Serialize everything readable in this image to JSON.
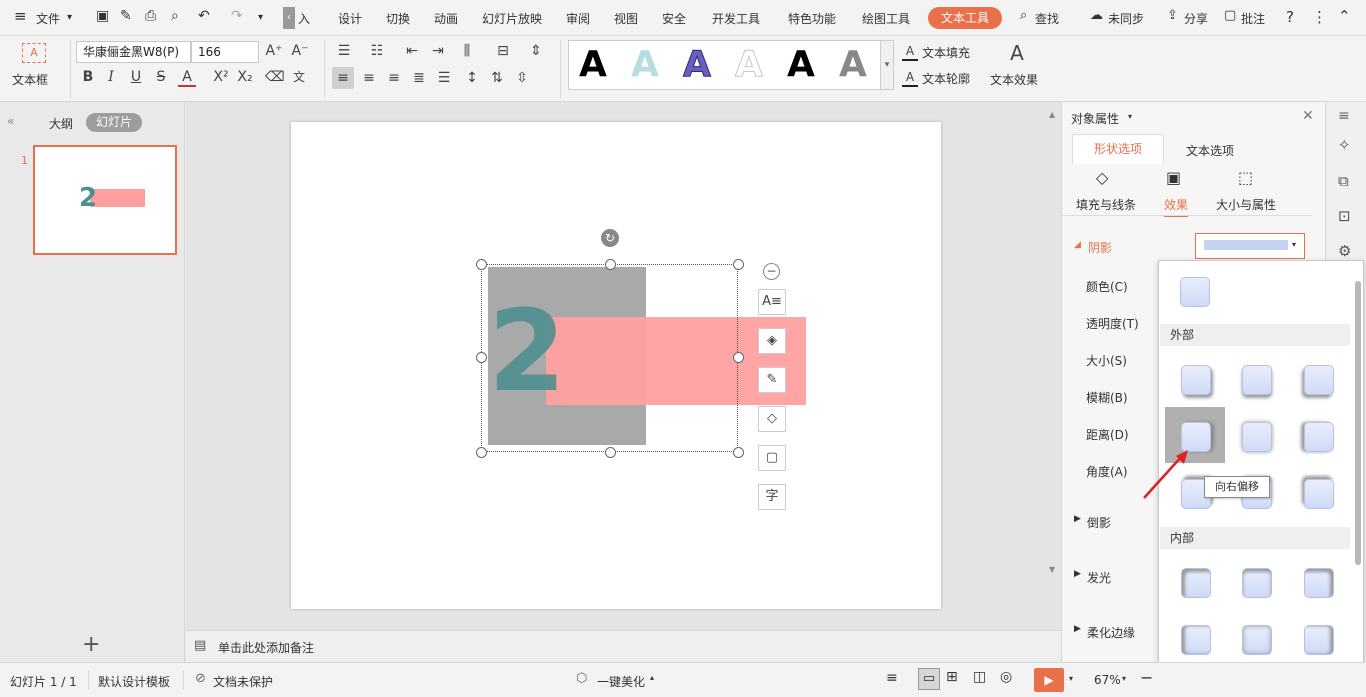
{
  "menubar": {
    "file_label": "文件",
    "tabs": [
      "设计",
      "切换",
      "动画",
      "幻灯片放映",
      "审阅",
      "视图",
      "安全",
      "开发工具",
      "特色功能",
      "绘图工具"
    ],
    "truncated_tab": "入",
    "active_tab": "文本工具",
    "search_label": "查找",
    "sync_label": "未同步",
    "share_label": "分享",
    "comment_label": "批注"
  },
  "ribbon": {
    "textbox_label": "文本框",
    "font_name": "华康俪金黑W8(P)",
    "font_size": "166",
    "art_letter": "A",
    "fill_label": "文本填充",
    "outline_label": "文本轮廓",
    "effect_label": "文本效果"
  },
  "leftpane": {
    "tab_outline": "大纲",
    "tab_slides": "幻灯片",
    "slide_number": "1",
    "thumb_text": "2"
  },
  "slide": {
    "big_text": "2"
  },
  "notes": {
    "placeholder": "单击此处添加备注"
  },
  "panel": {
    "title": "对象属性",
    "tab_shape": "形状选项",
    "tab_text": "文本选项",
    "sub_fill": "填充与线条",
    "sub_effect": "效果",
    "sub_size": "大小与属性",
    "section_shadow": "阴影",
    "color_label": "颜色(C)",
    "transparency_label": "透明度(T)",
    "size_label": "大小(S)",
    "blur_label": "模糊(B)",
    "distance_label": "距离(D)",
    "angle_label": "角度(A)",
    "section_reflection": "倒影",
    "section_glow": "发光",
    "section_soft": "柔化边缘"
  },
  "shadow_dropdown": {
    "outer_label": "外部",
    "inner_label": "内部",
    "tooltip": "向右偏移"
  },
  "statusbar": {
    "slide_info": "幻灯片 1 / 1",
    "template": "默认设计模板",
    "protect": "文档未保护",
    "beautify": "一键美化",
    "zoom": "67%"
  },
  "colors": {
    "accent": "#e8704a",
    "teal": "#4f8f8f",
    "salmon": "#ffa0a0"
  }
}
